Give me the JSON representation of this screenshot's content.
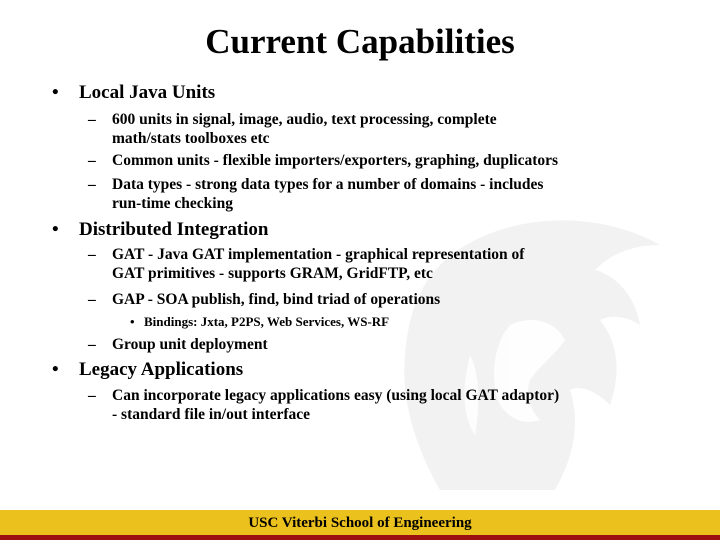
{
  "slide": {
    "title": "Current Capabilities",
    "sections": [
      {
        "heading": "Local Java Units",
        "items": [
          {
            "lines": [
              "600 units in signal, image, audio, text processing, complete",
              "math/stats toolboxes etc"
            ]
          },
          {
            "lines": [
              "Common units - flexible importers/exporters, graphing, duplicators"
            ]
          },
          {
            "lines": [
              "Data types - strong data types for a number of domains - includes",
              "run-time checking"
            ]
          }
        ]
      },
      {
        "heading": "Distributed Integration",
        "items": [
          {
            "lines": [
              "GAT - Java GAT implementation - graphical representation of",
              "GAT primitives - supports GRAM, GridFTP, etc"
            ]
          },
          {
            "lines": [
              "GAP - SOA publish, find, bind triad of operations"
            ],
            "subitems": [
              "Bindings: Jxta, P2PS, Web Services, WS-RF"
            ]
          },
          {
            "lines": [
              "Group unit deployment"
            ]
          }
        ]
      },
      {
        "heading": "Legacy Applications",
        "items": [
          {
            "lines": [
              "Can incorporate legacy applications easy (using local GAT adaptor)",
              "- standard file in/out interface"
            ]
          }
        ]
      }
    ],
    "bullet_glyph": "•",
    "dash_glyph": "–",
    "sub_bullet_glyph": "•"
  },
  "footer": {
    "text": "USC Viterbi School of Engineering",
    "bar_color": "#ebc11e",
    "strip_color": "#9b1010"
  },
  "watermark": {
    "icon": "trojan-helmet-icon"
  }
}
